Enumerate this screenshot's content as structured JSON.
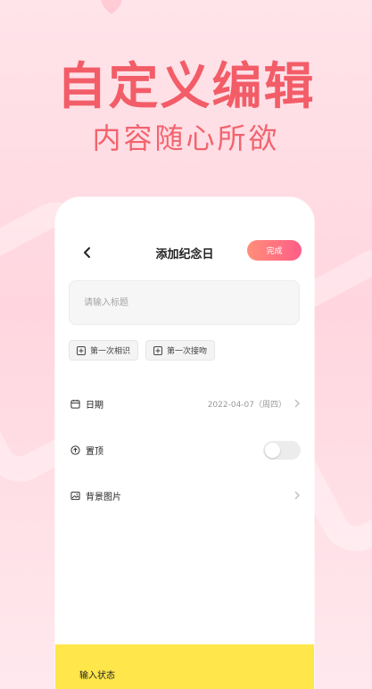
{
  "hero": {
    "title": "自定义编辑",
    "subtitle": "内容随心所欲"
  },
  "header": {
    "title": "添加纪念日",
    "done_label": "完成"
  },
  "title_input": {
    "placeholder": "请输入标题",
    "value": ""
  },
  "chips": [
    {
      "label": "第一次相识",
      "icon": "plus-square-icon"
    },
    {
      "label": "第一次接吻",
      "icon": "plus-square-icon"
    }
  ],
  "settings": {
    "date": {
      "label": "日期",
      "value": "2022-04-07（周四）",
      "icon": "calendar-icon"
    },
    "pin": {
      "label": "置顶",
      "enabled": false,
      "icon": "arrow-up-circle-icon"
    },
    "background": {
      "label": "背景图片",
      "icon": "image-icon"
    }
  },
  "bottom_bar": {
    "label": "输入状态"
  },
  "colors": {
    "accent": "#f25d68",
    "button_gradient_start": "#ff8e7a",
    "button_gradient_end": "#ff5d86",
    "bottom_bar": "#ffe64a"
  }
}
